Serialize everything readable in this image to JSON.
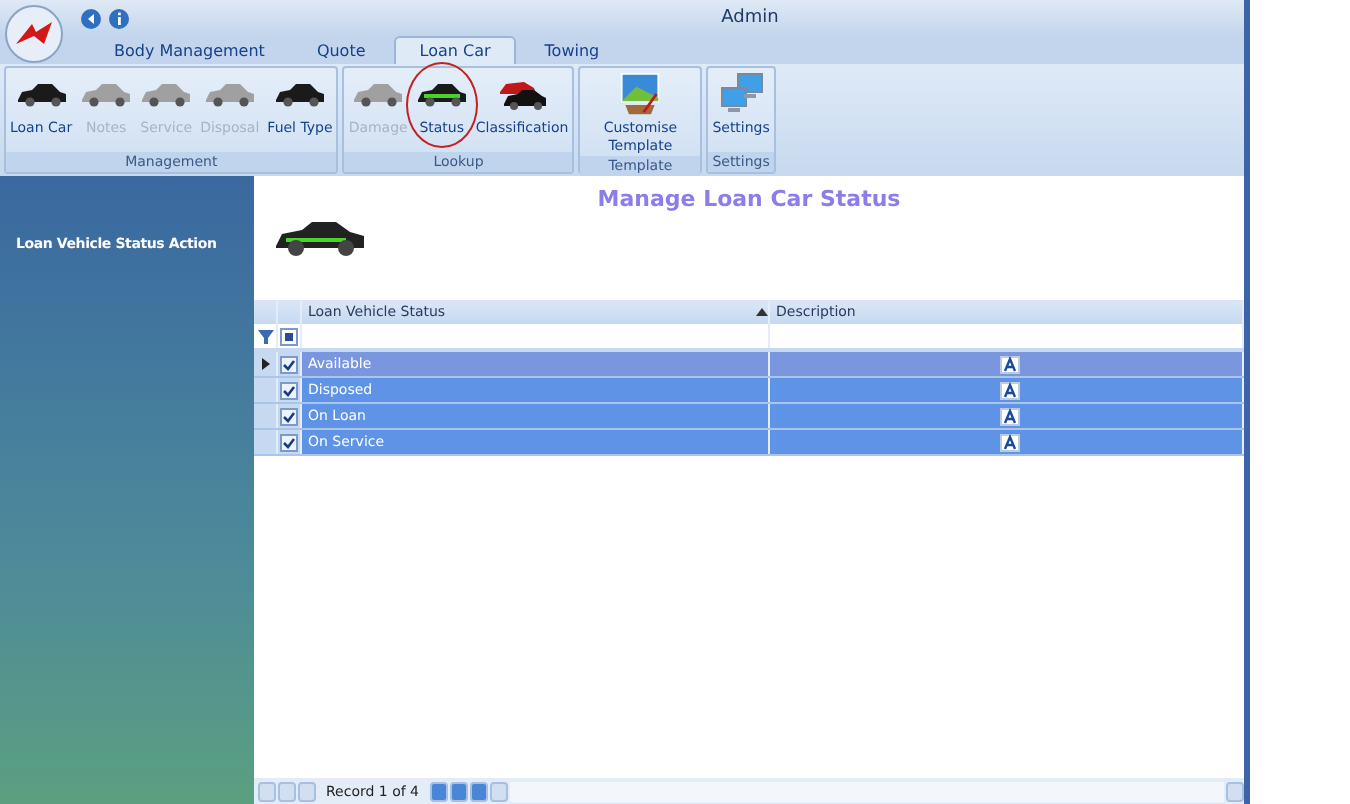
{
  "window": {
    "title": "Admin"
  },
  "tabs": [
    {
      "label": "Body Management",
      "selected": false
    },
    {
      "label": "Quote",
      "selected": false
    },
    {
      "label": "Loan Car",
      "selected": true
    },
    {
      "label": "Towing",
      "selected": false
    }
  ],
  "ribbon_groups": [
    {
      "label": "Management",
      "buttons": [
        {
          "label": "Loan Car",
          "kind": "car",
          "disabled": false,
          "circled": false
        },
        {
          "label": "Notes",
          "kind": "car",
          "disabled": true,
          "circled": false
        },
        {
          "label": "Service",
          "kind": "car",
          "disabled": true,
          "circled": false
        },
        {
          "label": "Disposal",
          "kind": "car",
          "disabled": true,
          "circled": false
        },
        {
          "label": "Fuel Type",
          "kind": "car",
          "disabled": false,
          "circled": false
        }
      ]
    },
    {
      "label": "Lookup",
      "buttons": [
        {
          "label": "Damage",
          "kind": "car",
          "disabled": true,
          "circled": false
        },
        {
          "label": "Status",
          "kind": "car",
          "disabled": false,
          "circled": true
        },
        {
          "label": "Classification",
          "kind": "cars",
          "disabled": false,
          "circled": false
        }
      ]
    },
    {
      "label": "Template",
      "buttons": [
        {
          "label": "Customise Template",
          "kind": "template",
          "disabled": false,
          "circled": false
        }
      ]
    },
    {
      "label": "Settings",
      "buttons": [
        {
          "label": "Settings",
          "kind": "monitors",
          "disabled": false,
          "circled": false
        }
      ]
    }
  ],
  "sidebar": {
    "title": "Loan Vehicle Status Action"
  },
  "page_title": "Manage Loan Car Status",
  "table": {
    "columns": [
      "Loan Vehicle Status",
      "Description"
    ],
    "rows": [
      {
        "status": "Available",
        "checked": true,
        "selected": true
      },
      {
        "status": "Disposed",
        "checked": true,
        "selected": false
      },
      {
        "status": "On Loan",
        "checked": true,
        "selected": false
      },
      {
        "status": "On Service",
        "checked": true,
        "selected": false
      }
    ]
  },
  "navigator": {
    "text": "Record 1 of 4"
  }
}
